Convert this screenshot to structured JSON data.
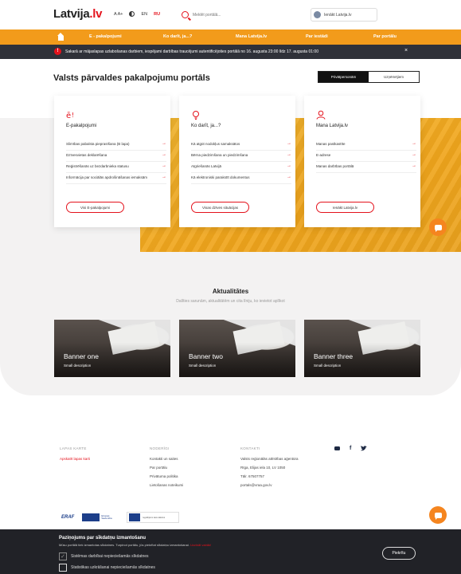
{
  "header": {
    "logo_text": "Latvija",
    "logo_accent": ".lv",
    "text_size_label": "A A+",
    "language_current": "EN",
    "language_other": "RU",
    "search_placeholder": "Meklēt portālā...",
    "login_label": "Ienākt Latvija.lv"
  },
  "nav": {
    "items": [
      {
        "label": "E - pakalpojumi"
      },
      {
        "label": "Ko darīt, ja...?"
      },
      {
        "label": "Mana Latvija.lv"
      },
      {
        "label": "Par iestādi"
      },
      {
        "label": "Par portālu"
      }
    ]
  },
  "alert": {
    "icon": "!",
    "text": "Sakarā ar mājaslapas uzlabošanas darbiem, iespējami darbības traucējumi autentificējoties portālā no 16. augusta 23:00 līdz 17. augusta 01:00",
    "close": "×"
  },
  "main": {
    "title": "Valsts pārvaldes pakalpojumu portāls",
    "segment_active": "Privātpersonām",
    "segment_inactive": "Uzņēmējiem"
  },
  "cards": [
    {
      "icon": "e-services-icon",
      "title": "E-pakalpojumi",
      "links": [
        "Slimības pabalsta pieprasīšana (B lapa)",
        "Dzīvesvietas deklarēšana",
        "Reģistrēšanās uz bezdarbnieka statusu",
        "Informācija par sociālās apdrošināšanas iemaksām"
      ],
      "button": "Visi E-pakalpojumi"
    },
    {
      "icon": "lightbulb-icon",
      "title": "Ko darīt, ja...?",
      "links": [
        "Kā atgūt nodokļus samaksātos",
        "Bērna piedzimšana un piedzimšana",
        "Atgriešanās Latvijā",
        "Kā elektroniski parakstīt dokumentus"
      ],
      "button": "Visas dzīves situācijas"
    },
    {
      "icon": "user-icon",
      "title": "Mana Latvija.lv",
      "links": [
        "Manas pastkastīte",
        "E-adrese",
        "Manas darbības portālā"
      ],
      "button": "Ienākt Latvija.lv"
    }
  ],
  "news": {
    "title": "Aktualitātes",
    "subtitle": "Dalīties sarunām, aktualitātēm un cita līniju, ko ievietot aplīkot",
    "banners": [
      {
        "title": "Banner one",
        "desc": "Small description"
      },
      {
        "title": "Banner two",
        "desc": "Small description"
      },
      {
        "title": "Banner three",
        "desc": "Small description"
      }
    ]
  },
  "footer": {
    "col1": {
      "head": "LAPAS KARTE",
      "items": [
        "Apskatīt lapas karti"
      ]
    },
    "col2": {
      "head": "NODERĪGI",
      "items": [
        "Kontakti un saites",
        "Par portālu",
        "Privātuma politika",
        "Lietošanas noteikumi"
      ]
    },
    "col3": {
      "head": "KONTAKTI",
      "items": [
        "Valsts reģionālās attīstības aģentūra",
        "Rīga, Elijas iela 10, LV 1050",
        "Tālr. 67507757",
        "portals@vraa.gov.lv"
      ]
    },
    "social": [
      "youtube-icon",
      "facebook-icon",
      "twitter-icon"
    ],
    "logos": {
      "erdf": "ERAF",
      "eu_text": "Eiropas Savienība",
      "invest_text": "Ieguldījums tavā nākotnē"
    }
  },
  "cookie": {
    "title": "Paziņojums par sīkdatņu izmantošanu",
    "text": "Mūsu portālā tiek izmantotas sīkdatnes. Turpinot portālu, jūs piekrītat sīkdatņu izmantošanai.",
    "link": "Uzzināt vairāk!",
    "option1": "Sistēmas darbībai nepieciešamās sīkdatnes",
    "option2": "Statistikas uzkrāšanai nepieciešamās sīkdatnes",
    "accept": "Piekrītu"
  },
  "colors": {
    "accent": "#e4121c",
    "nav_orange": "#f29b1b",
    "chat_orange": "#f5851f",
    "dark": "#2f3139"
  }
}
